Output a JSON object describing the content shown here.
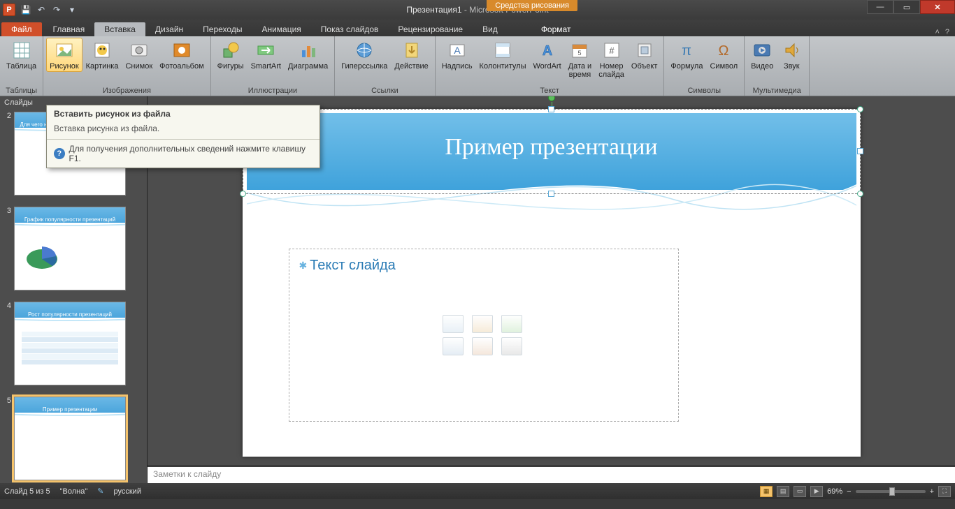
{
  "titlebar": {
    "doc": "Презентация1",
    "app": "Microsoft PowerPoint",
    "contextual": "Средства рисования"
  },
  "tabs": {
    "file": "Файл",
    "items": [
      "Главная",
      "Вставка",
      "Дизайн",
      "Переходы",
      "Анимация",
      "Показ слайдов",
      "Рецензирование",
      "Вид"
    ],
    "context": "Формат",
    "active_index": 1
  },
  "ribbon": {
    "groups": [
      {
        "label": "Таблицы",
        "buttons": [
          {
            "name": "table",
            "text": "Таблица",
            "icon": "grid"
          }
        ]
      },
      {
        "label": "Изображения",
        "buttons": [
          {
            "name": "picture",
            "text": "Рисунок",
            "icon": "pic",
            "active": true
          },
          {
            "name": "clipart",
            "text": "Картинка",
            "icon": "clip"
          },
          {
            "name": "screenshot",
            "text": "Снимок",
            "icon": "shot"
          },
          {
            "name": "album",
            "text": "Фотоальбом",
            "icon": "album"
          }
        ]
      },
      {
        "label": "Иллюстрации",
        "buttons": [
          {
            "name": "shapes",
            "text": "Фигуры",
            "icon": "shapes"
          },
          {
            "name": "smartart",
            "text": "SmartArt",
            "icon": "smart"
          },
          {
            "name": "chart",
            "text": "Диаграмма",
            "icon": "chart"
          }
        ]
      },
      {
        "label": "Ссылки",
        "buttons": [
          {
            "name": "hyperlink",
            "text": "Гиперссылка",
            "icon": "link"
          },
          {
            "name": "action",
            "text": "Действие",
            "icon": "action"
          }
        ]
      },
      {
        "label": "Текст",
        "buttons": [
          {
            "name": "textbox",
            "text": "Надпись",
            "icon": "tbox"
          },
          {
            "name": "headerfooter",
            "text": "Колонтитулы",
            "icon": "hf"
          },
          {
            "name": "wordart",
            "text": "WordArt",
            "icon": "wa"
          },
          {
            "name": "datetime",
            "text": "Дата и\nвремя",
            "icon": "date"
          },
          {
            "name": "slidenum",
            "text": "Номер\nслайда",
            "icon": "num"
          },
          {
            "name": "object",
            "text": "Объект",
            "icon": "obj"
          }
        ]
      },
      {
        "label": "Символы",
        "buttons": [
          {
            "name": "equation",
            "text": "Формула",
            "icon": "eq"
          },
          {
            "name": "symbol",
            "text": "Символ",
            "icon": "sym"
          }
        ]
      },
      {
        "label": "Мультимедиа",
        "buttons": [
          {
            "name": "video",
            "text": "Видео",
            "icon": "vid"
          },
          {
            "name": "audio",
            "text": "Звук",
            "icon": "aud"
          }
        ]
      }
    ]
  },
  "sidebar": {
    "header": "Слайды",
    "thumbs": [
      {
        "num": "2",
        "title": "Для чего нужна программа PowerPoint"
      },
      {
        "num": "3",
        "title": "График популярности презентаций"
      },
      {
        "num": "4",
        "title": "Рост популярности презентаций"
      },
      {
        "num": "5",
        "title": "Пример презентации",
        "selected": true
      }
    ]
  },
  "tooltip": {
    "header": "Вставить рисунок из файла",
    "body": "Вставка рисунка из файла.",
    "footer": "Для получения дополнительных сведений нажмите клавишу F1."
  },
  "slide": {
    "title": "Пример презентации",
    "content_placeholder": "Текст слайда"
  },
  "notes": {
    "placeholder": "Заметки к слайду"
  },
  "status": {
    "slide_info": "Слайд 5 из 5",
    "theme": "\"Волна\"",
    "language": "русский",
    "zoom": "69%"
  }
}
